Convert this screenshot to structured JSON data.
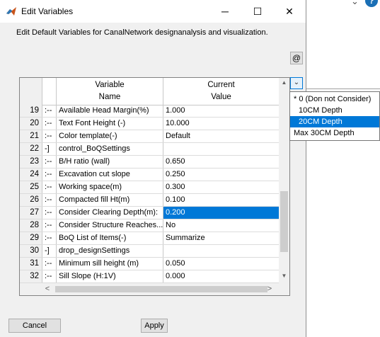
{
  "window": {
    "title": "Edit Variables",
    "minimize_glyph": "─",
    "maximize_glyph": "☐",
    "close_glyph": "✕",
    "icon": "matlab-icon"
  },
  "description": "Edit Default Variables for CanalNetwork designanalysis and visualization.",
  "at_button_label": "@",
  "table": {
    "headers": {
      "variable_line1": "Variable",
      "variable_line2": "Name",
      "value_line1": "Current",
      "value_line2": "Value"
    },
    "rows": [
      {
        "num": "19",
        "tree": ":--",
        "name": "Available Head Margin(%)",
        "value": "1.000"
      },
      {
        "num": "20",
        "tree": ":--",
        "name": "Text Font Height (-)",
        "value": "10.000"
      },
      {
        "num": "21",
        "tree": ":--",
        "name": "Color template(-)",
        "value": "Default"
      },
      {
        "num": "22",
        "tree": "-]",
        "name": "control_BoQSettings",
        "value": ""
      },
      {
        "num": "23",
        "tree": ":--",
        "name": "B/H ratio (wall)",
        "value": "0.650"
      },
      {
        "num": "24",
        "tree": ":--",
        "name": "Excavation cut slope",
        "value": "0.250"
      },
      {
        "num": "25",
        "tree": ":--",
        "name": "Working space(m)",
        "value": "0.300"
      },
      {
        "num": "26",
        "tree": ":--",
        "name": "Compacted fill Ht(m)",
        "value": "0.100"
      },
      {
        "num": "27",
        "tree": ":--",
        "name": "Consider Clearing Depth(m):",
        "value": "0.200"
      },
      {
        "num": "28",
        "tree": ":--",
        "name": "Consider Structure Reaches...",
        "value": "No"
      },
      {
        "num": "29",
        "tree": ":--",
        "name": "BoQ List of Items(-)",
        "value": "Summarize"
      },
      {
        "num": "30",
        "tree": "-]",
        "name": "drop_designSettings",
        "value": ""
      },
      {
        "num": "31",
        "tree": ":--",
        "name": "Minimum sill height (m)",
        "value": "0.050"
      },
      {
        "num": "32",
        "tree": ":--",
        "name": "Sill Slope (H:1V)",
        "value": "0.000"
      }
    ],
    "selected_row": "27",
    "scroll": {
      "up": "▲",
      "down": "▼",
      "left": "<",
      "right": ">"
    }
  },
  "dropdown": {
    "button_glyph": "⌄",
    "options": [
      "* 0 (Don not Consider)",
      "10CM Depth",
      "20CM Depth",
      "Max 30CM Depth"
    ],
    "selected": "20CM Depth"
  },
  "buttons": {
    "cancel": "Cancel",
    "apply": "Apply"
  },
  "background_app": {
    "chevron_glyph": "⌄",
    "help_label": "?"
  },
  "colors": {
    "selection": "#0078d7",
    "dialog_bg": "#f0f0f0"
  }
}
